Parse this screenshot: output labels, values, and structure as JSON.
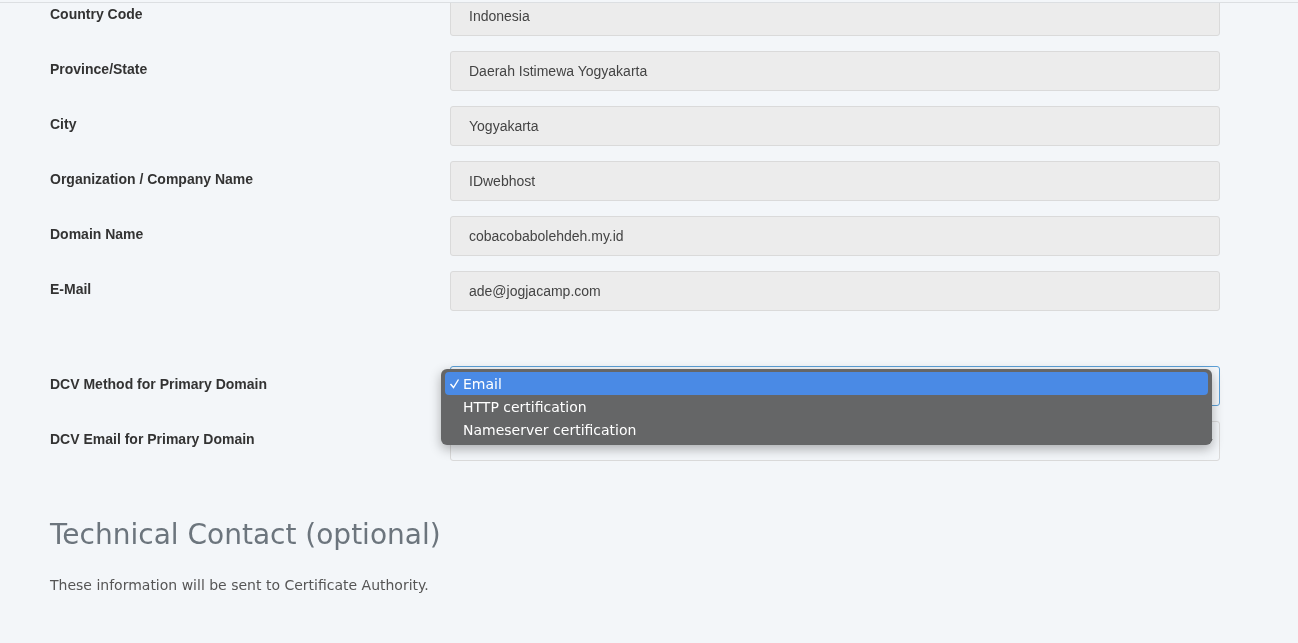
{
  "fields": [
    {
      "label": "Country Code",
      "value": "Indonesia"
    },
    {
      "label": "Province/State",
      "value": "Daerah Istimewa Yogyakarta"
    },
    {
      "label": "City",
      "value": "Yogyakarta"
    },
    {
      "label": "Organization / Company Name",
      "value": "IDwebhost"
    },
    {
      "label": "Domain Name",
      "value": "cobacobabolehdeh.my.id"
    },
    {
      "label": "E-Mail",
      "value": "ade@jogjacamp.com"
    }
  ],
  "selects": [
    {
      "label": "DCV Method for Primary Domain",
      "expanded": true,
      "options": [
        {
          "label": "Email",
          "selected": true
        },
        {
          "label": "HTTP certification",
          "selected": false
        },
        {
          "label": "Nameserver certification",
          "selected": false
        }
      ]
    },
    {
      "label": "DCV Email for Primary Domain",
      "expanded": false
    }
  ],
  "section": {
    "title": "Technical Contact (optional)",
    "note": "These information will be sent to Certificate Authority."
  }
}
